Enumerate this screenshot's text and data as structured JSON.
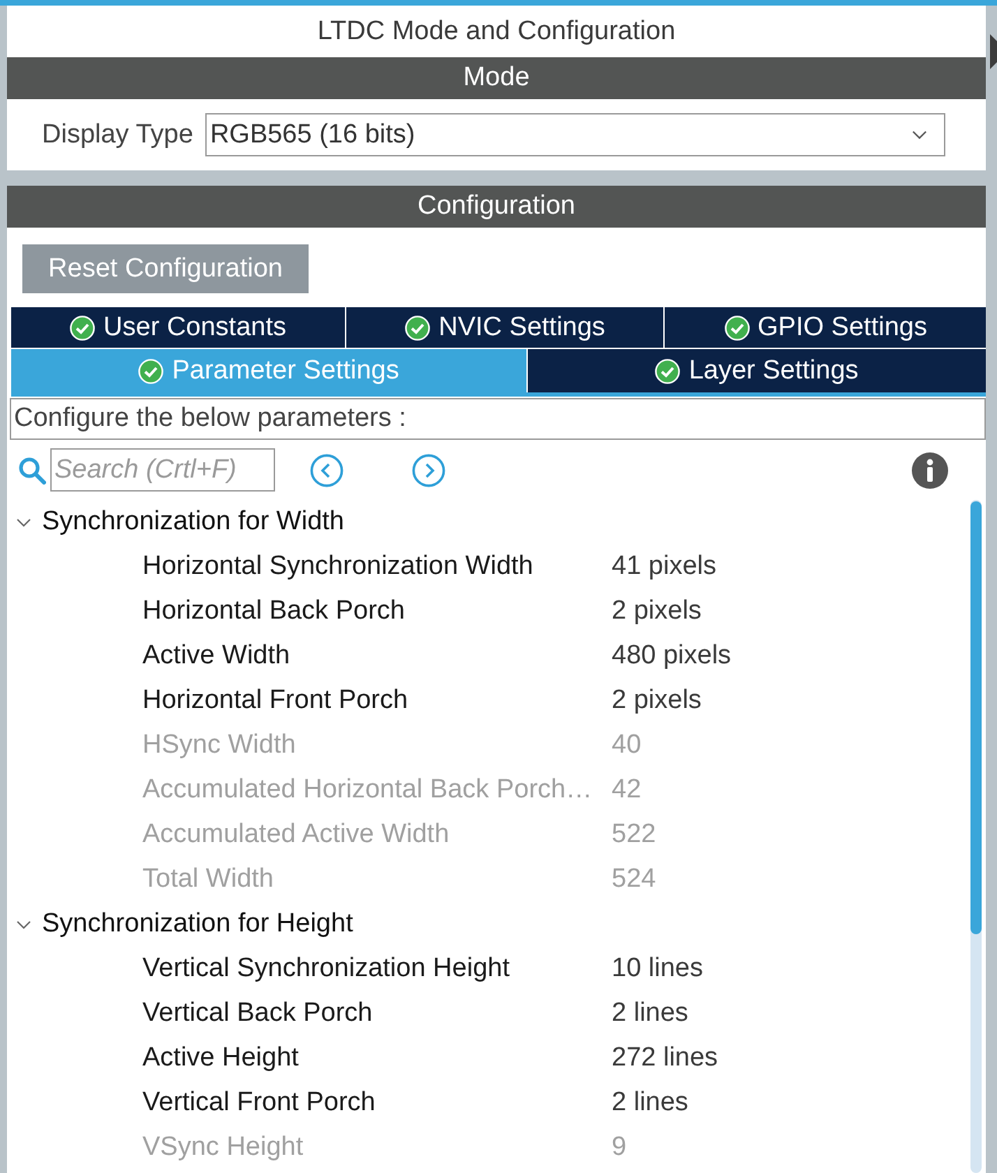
{
  "window": {
    "title": "LTDC Mode and Configuration"
  },
  "mode": {
    "header": "Mode",
    "display_type": {
      "label": "Display Type",
      "value": "RGB565 (16 bits)"
    }
  },
  "configuration": {
    "header": "Configuration",
    "reset_button": "Reset Configuration",
    "tab_rows": [
      {
        "tabs": [
          {
            "label": "User Constants",
            "selected": false
          },
          {
            "label": "NVIC Settings",
            "selected": false
          },
          {
            "label": "GPIO Settings",
            "selected": false
          }
        ]
      },
      {
        "tabs": [
          {
            "label": "Parameter Settings",
            "selected": true
          },
          {
            "label": "Layer Settings",
            "selected": false
          }
        ]
      }
    ],
    "hint": "Configure the below parameters :",
    "search": {
      "placeholder": "Search (Crtl+F)"
    },
    "groups": [
      {
        "title": "Synchronization for Width",
        "expanded": true,
        "params": [
          {
            "label": "Horizontal Synchronization Width",
            "value": "41 pixels",
            "disabled": false
          },
          {
            "label": "Horizontal Back Porch",
            "value": "2 pixels",
            "disabled": false
          },
          {
            "label": "Active Width",
            "value": "480 pixels",
            "disabled": false
          },
          {
            "label": "Horizontal Front Porch",
            "value": "2 pixels",
            "disabled": false
          },
          {
            "label": "HSync Width",
            "value": "40",
            "disabled": true
          },
          {
            "label": "Accumulated Horizontal Back Porch…",
            "value": "42",
            "disabled": true
          },
          {
            "label": "Accumulated Active Width",
            "value": "522",
            "disabled": true
          },
          {
            "label": "Total Width",
            "value": "524",
            "disabled": true
          }
        ]
      },
      {
        "title": "Synchronization for Height",
        "expanded": true,
        "params": [
          {
            "label": "Vertical Synchronization Height",
            "value": "10 lines",
            "disabled": false
          },
          {
            "label": "Vertical Back Porch",
            "value": "2 lines",
            "disabled": false
          },
          {
            "label": "Active Height",
            "value": "272 lines",
            "disabled": false
          },
          {
            "label": "Vertical Front Porch",
            "value": "2 lines",
            "disabled": false
          },
          {
            "label": "VSync Height",
            "value": "9",
            "disabled": true
          }
        ]
      }
    ]
  }
}
